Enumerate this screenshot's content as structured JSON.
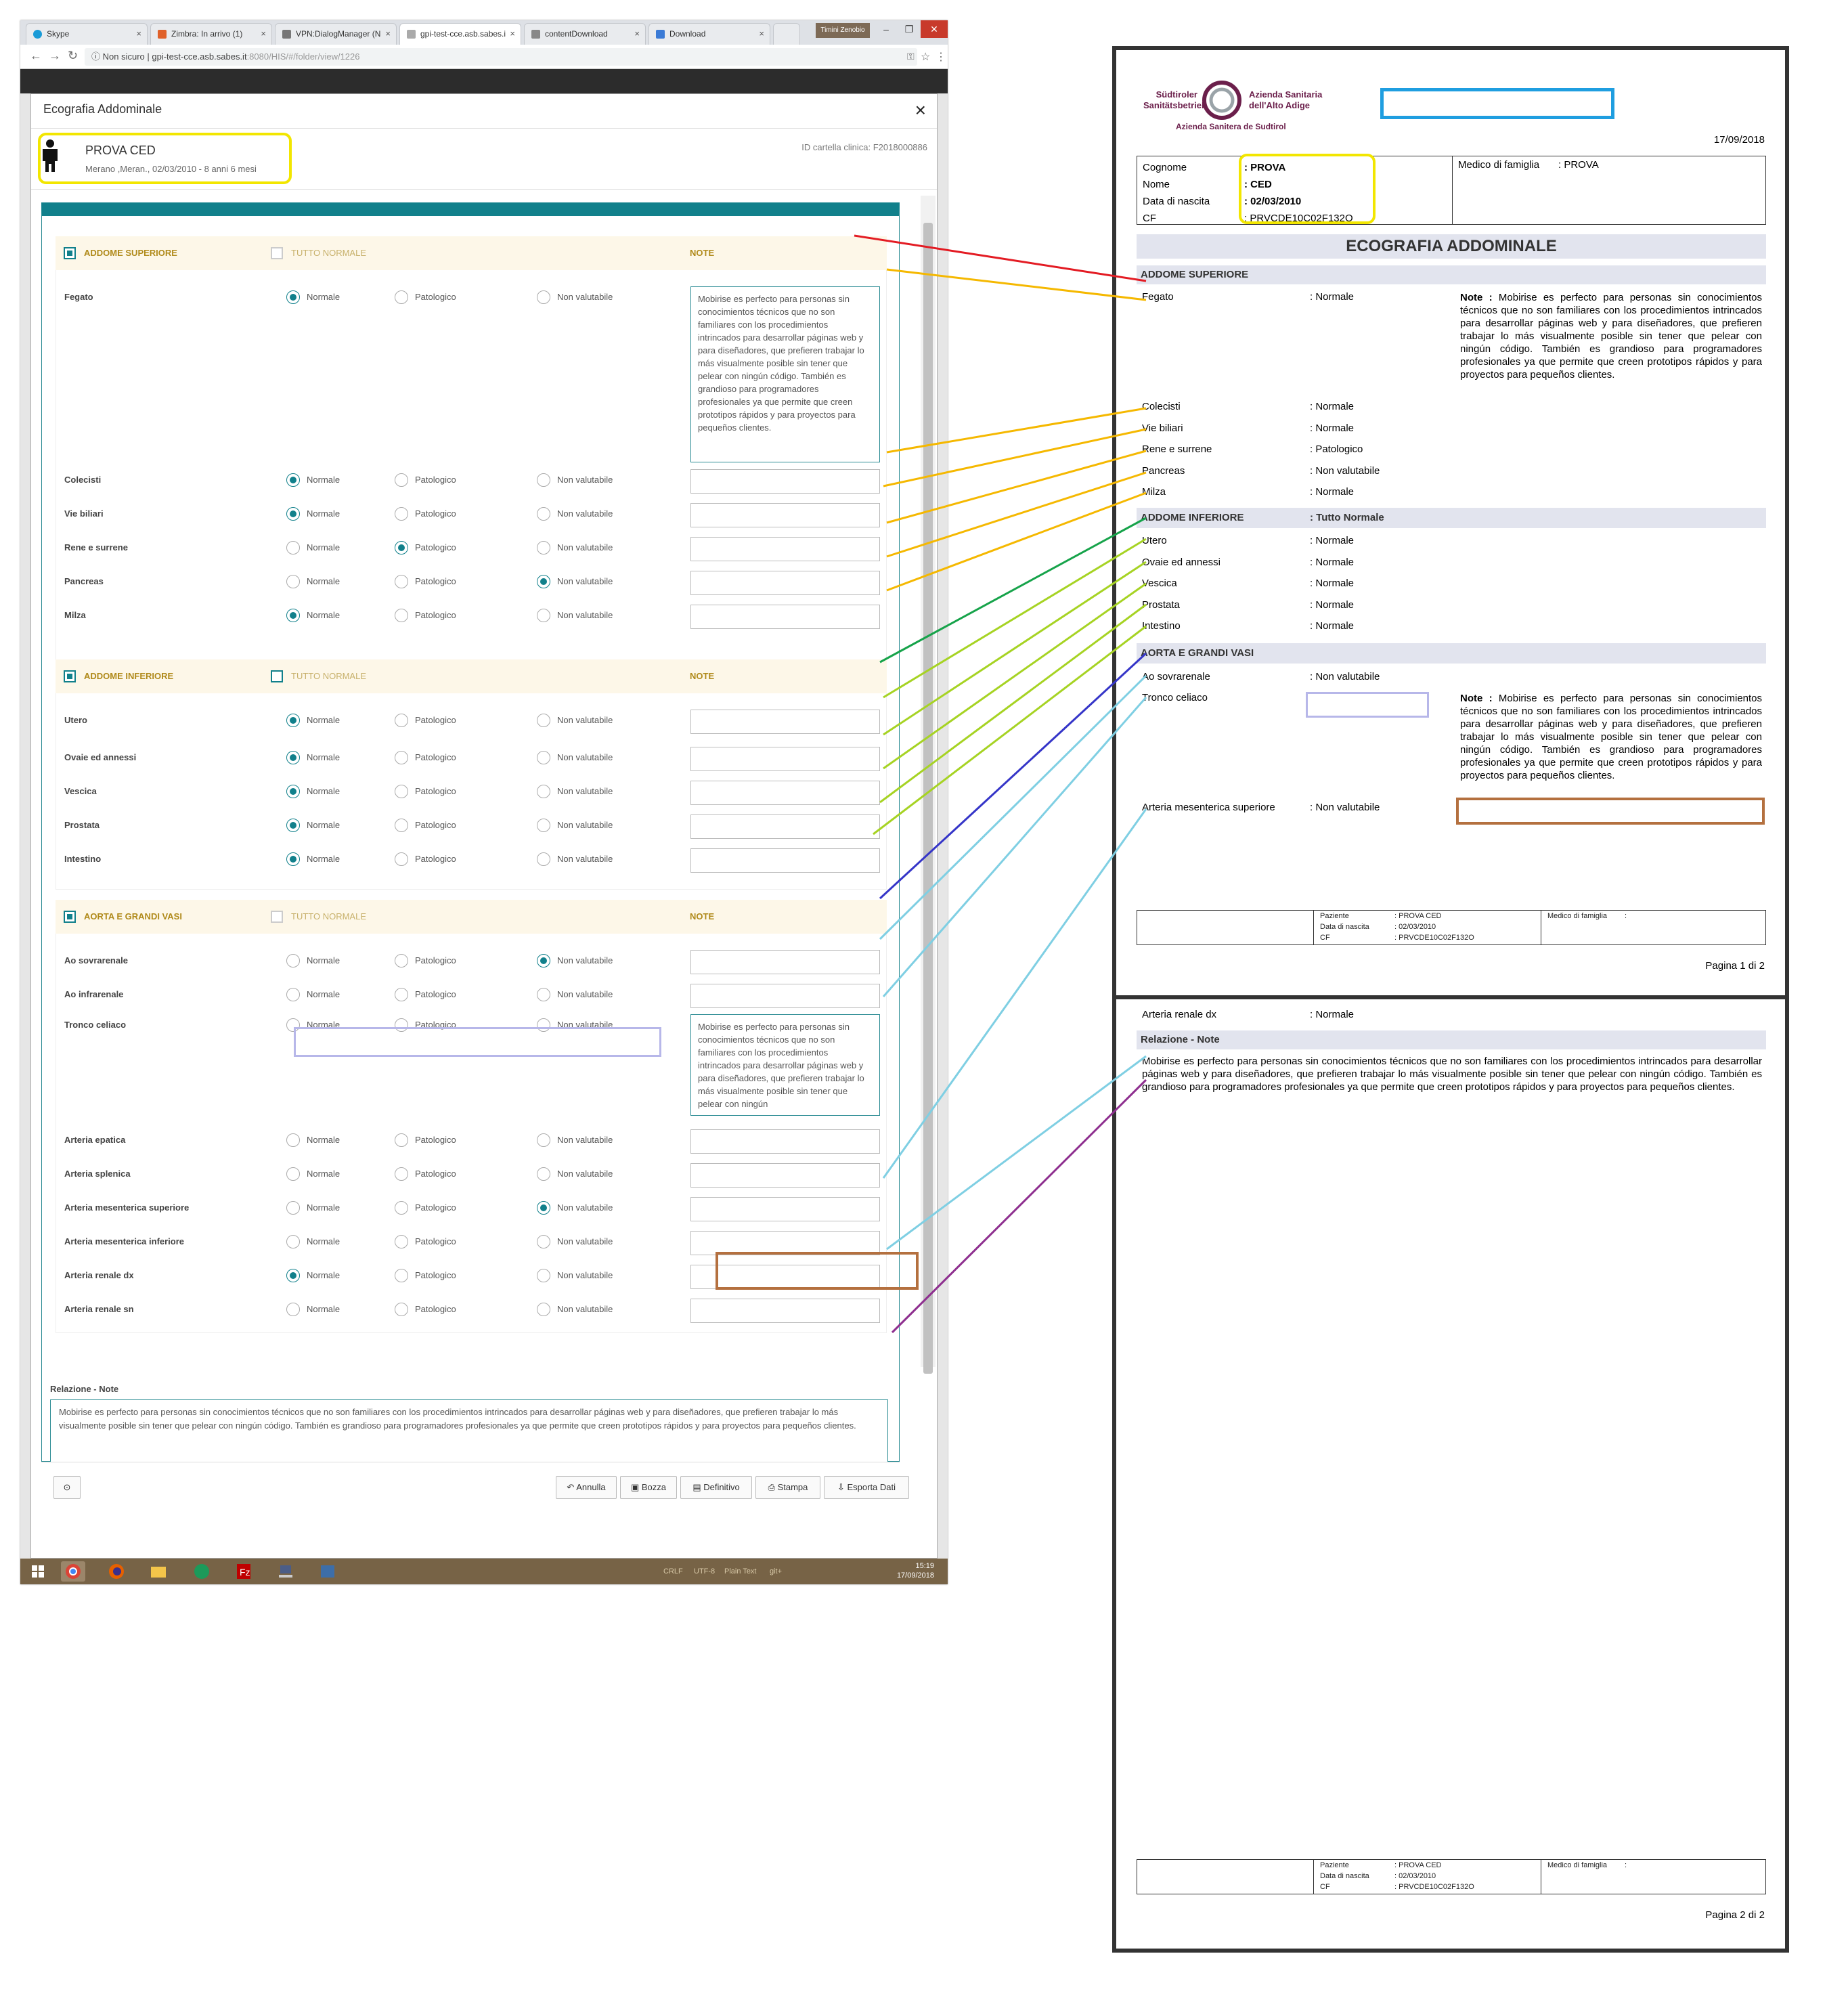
{
  "browser": {
    "tabs": [
      {
        "label": "Skype",
        "color": "#1a9bd7"
      },
      {
        "label": "Zimbra: In arrivo (1)",
        "color": "#e0612a"
      },
      {
        "label": "VPN:DialogManager (N",
        "color": "#777777"
      },
      {
        "label": "gpi-test-cce.asb.sabes.i",
        "color": "#999999"
      },
      {
        "label": "contentDownload",
        "color": "#888888"
      },
      {
        "label": "Download",
        "color": "#3b7bd6"
      }
    ],
    "user_badge": "Timini Zenobio",
    "url_prefix": "Non sicuro",
    "url_host": "gpi-test-cce.asb.sabes.it",
    "url_rest": ":8080/HIS/#/folder/view/1226"
  },
  "modal": {
    "title": "Ecografia Addominale",
    "close_label": "×",
    "patient_name": "PROVA CED",
    "patient_info": "Merano ,Meran., 02/03/2010 - 8 anni 6 mesi",
    "record_id": "ID cartella clinica: F2018000886",
    "radio_labels": [
      "Normale",
      "Patologico",
      "Non valutabile"
    ],
    "tutto_normale": "TUTTO NORMALE",
    "note_label": "NOTE",
    "sections": [
      {
        "title": "ADDOME SUPERIORE",
        "checked": true,
        "tutto_checked": false,
        "rows": [
          {
            "label": "Fegato",
            "selected": 0,
            "note": "Mobirise es perfecto para personas sin conocimientos técnicos que no son familiares con los procedimientos intrincados para desarrollar páginas web y para diseñadores, que prefieren trabajar lo más visualmente posible sin tener que pelear con ningún código. También es grandioso para programadores profesionales ya que permite que creen prototipos rápidos y para proyectos para pequeños clientes."
          },
          {
            "label": "Colecisti",
            "selected": 0,
            "note": ""
          },
          {
            "label": "Vie biliari",
            "selected": 0,
            "note": ""
          },
          {
            "label": "Rene e surrene",
            "selected": 1,
            "note": ""
          },
          {
            "label": "Pancreas",
            "selected": 2,
            "note": ""
          },
          {
            "label": "Milza",
            "selected": 0,
            "note": ""
          }
        ]
      },
      {
        "title": "ADDOME INFERIORE",
        "checked": true,
        "tutto_checked": true,
        "rows": [
          {
            "label": "Utero",
            "selected": 0,
            "note": ""
          },
          {
            "label": "Ovaie ed annessi",
            "selected": 0,
            "note": ""
          },
          {
            "label": "Vescica",
            "selected": 0,
            "note": ""
          },
          {
            "label": "Prostata",
            "selected": 0,
            "note": ""
          },
          {
            "label": "Intestino",
            "selected": 0,
            "note": ""
          }
        ]
      },
      {
        "title": "AORTA E GRANDI VASI",
        "checked": true,
        "tutto_checked": false,
        "rows": [
          {
            "label": "Ao sovrarenale",
            "selected": 2,
            "note": ""
          },
          {
            "label": "Ao infrarenale",
            "selected": -1,
            "note": ""
          },
          {
            "label": "Tronco celiaco",
            "selected": -1,
            "note": "Mobirise es perfecto para personas sin conocimientos técnicos que no son familiares con los procedimientos intrincados para desarrollar páginas web y para diseñadores, que prefieren trabajar lo más visualmente posible sin tener que pelear con ningún"
          },
          {
            "label": "Arteria epatica",
            "selected": -1,
            "note": ""
          },
          {
            "label": "Arteria splenica",
            "selected": -1,
            "note": ""
          },
          {
            "label": "Arteria mesenterica superiore",
            "selected": 2,
            "note": ""
          },
          {
            "label": "Arteria mesenterica inferiore",
            "selected": -1,
            "note": ""
          },
          {
            "label": "Arteria renale dx",
            "selected": 0,
            "note": ""
          },
          {
            "label": "Arteria renale sn",
            "selected": -1,
            "note": ""
          }
        ]
      }
    ],
    "relazione_label": "Relazione - Note",
    "relazione_text": "Mobirise es perfecto para personas sin conocimientos técnicos que no son familiares con los procedimientos intrincados para desarrollar páginas web y para diseñadores, que prefieren trabajar lo más visualmente posible sin tener que pelear con ningún código. También es grandioso para programadores profesionales ya que permite que creen prototipos rápidos y para proyectos para pequeños clientes.",
    "buttons": {
      "history": "⊙",
      "annulla": "Annulla",
      "bozza": "Bozza",
      "definitivo": "Definitivo",
      "stampa": "Stampa",
      "esporta": "Esporta Dati"
    }
  },
  "taskbar": {
    "status": [
      "CRLF",
      "UTF-8",
      "Plain Text",
      "git+"
    ],
    "time": "15:19",
    "date": "17/09/2018"
  },
  "report": {
    "logo_left_1": "Südtiroler",
    "logo_left_2": "Sanitätsbetrieb",
    "logo_right_1": "Azienda Sanitaria",
    "logo_right_2": "dell'Alto Adige",
    "logo_bottom": "Azienda Sanitera de Sudtirol",
    "date": "17/09/2018",
    "info": {
      "cognome_label": "Cognome",
      "cognome": ": PROVA",
      "nome_label": "Nome",
      "nome": ": CED",
      "nascita_label": "Data di nascita",
      "nascita": ": 02/03/2010",
      "cf_label": "CF",
      "cf": ": PRVCDE10C02F132O",
      "medico_label": "Medico di famiglia",
      "medico": ": PROVA"
    },
    "title": "ECOGRAFIA ADDOMINALE",
    "sec1_title": "ADDOME SUPERIORE",
    "fegato_label": "Fegato",
    "fegato_value": ": Normale",
    "note_prefix": "Note :",
    "note_text": "Mobirise es perfecto para personas sin conocimientos técnicos que no son familiares con los procedimientos intrincados para desarrollar páginas web y para diseñadores, que prefieren trabajar lo más visualmente posible sin tener que pelear con ningún código. También es grandioso para programadores profesionales ya que permite que creen prototipos rápidos y para proyectos para pequeños clientes.",
    "sec1_rows": [
      {
        "label": "Colecisti",
        "value": ": Normale"
      },
      {
        "label": "Vie biliari",
        "value": ": Normale"
      },
      {
        "label": "Rene e surrene",
        "value": ": Patologico"
      },
      {
        "label": "Pancreas",
        "value": ": Non valutabile"
      },
      {
        "label": "Milza",
        "value": ": Normale"
      }
    ],
    "sec2_title": "ADDOME INFERIORE",
    "sec2_value": ": Tutto Normale",
    "sec2_rows": [
      {
        "label": "Utero",
        "value": ": Normale"
      },
      {
        "label": "Ovaie ed annessi",
        "value": ": Normale"
      },
      {
        "label": "Vescica",
        "value": ": Normale"
      },
      {
        "label": "Prostata",
        "value": ": Normale"
      },
      {
        "label": "Intestino",
        "value": ": Normale"
      }
    ],
    "sec3_title": "AORTA E GRANDI VASI",
    "ao_label": "Ao sovrarenale",
    "ao_value": ": Non valutabile",
    "tronco_label": "Tronco celiaco",
    "ams_label": "Arteria mesenterica superiore",
    "ams_value": ": Non valutabile",
    "footer": {
      "paziente_label": "Paziente",
      "paziente": ": PROVA CED",
      "nascita_label": "Data di nascita",
      "nascita": ": 02/03/2010",
      "cf_label": "CF",
      "cf": ": PRVCDE10C02F132O",
      "medico_label": "Medico di famiglia",
      "medico": ":"
    },
    "page1_label": "Pagina 1 di 2",
    "renale_label": "Arteria renale dx",
    "renale_value": ": Normale",
    "relazione_title": "Relazione - Note",
    "relazione_text": "Mobirise es perfecto para personas sin conocimientos técnicos que no son familiares con los procedimientos intrincados para desarrollar páginas web y para diseñadores, que prefieren trabajar lo más visualmente posible sin tener que pelear con ningún código. También es grandioso para programadores profesionales ya que permite que creen prototipos rápidos y para proyectos para pequeños clientes.",
    "page2_label": "Pagina 2 di 2"
  },
  "annotation_colors": {
    "sections": "#e31b23",
    "sec1_rows": "#f5b800",
    "sec2": "#16a34a",
    "sec2_rows": "#a6d323",
    "sec3": "#3535c8",
    "sec3_rows": "#7fcfe3",
    "relazione": "#8e2f8f",
    "yellow_box": "#f2e600",
    "blue_box": "#1f9ee0",
    "purple_box": "#b7b7e9",
    "brown_box": "#b4703f"
  }
}
